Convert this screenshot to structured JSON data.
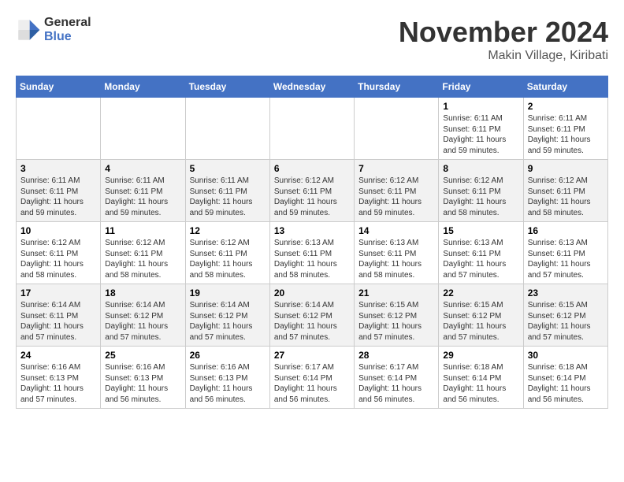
{
  "header": {
    "logo_general": "General",
    "logo_blue": "Blue",
    "month_title": "November 2024",
    "location": "Makin Village, Kiribati"
  },
  "days_of_week": [
    "Sunday",
    "Monday",
    "Tuesday",
    "Wednesday",
    "Thursday",
    "Friday",
    "Saturday"
  ],
  "weeks": [
    [
      {
        "day": "",
        "info": ""
      },
      {
        "day": "",
        "info": ""
      },
      {
        "day": "",
        "info": ""
      },
      {
        "day": "",
        "info": ""
      },
      {
        "day": "",
        "info": ""
      },
      {
        "day": "1",
        "info": "Sunrise: 6:11 AM\nSunset: 6:11 PM\nDaylight: 11 hours\nand 59 minutes."
      },
      {
        "day": "2",
        "info": "Sunrise: 6:11 AM\nSunset: 6:11 PM\nDaylight: 11 hours\nand 59 minutes."
      }
    ],
    [
      {
        "day": "3",
        "info": "Sunrise: 6:11 AM\nSunset: 6:11 PM\nDaylight: 11 hours\nand 59 minutes."
      },
      {
        "day": "4",
        "info": "Sunrise: 6:11 AM\nSunset: 6:11 PM\nDaylight: 11 hours\nand 59 minutes."
      },
      {
        "day": "5",
        "info": "Sunrise: 6:11 AM\nSunset: 6:11 PM\nDaylight: 11 hours\nand 59 minutes."
      },
      {
        "day": "6",
        "info": "Sunrise: 6:12 AM\nSunset: 6:11 PM\nDaylight: 11 hours\nand 59 minutes."
      },
      {
        "day": "7",
        "info": "Sunrise: 6:12 AM\nSunset: 6:11 PM\nDaylight: 11 hours\nand 59 minutes."
      },
      {
        "day": "8",
        "info": "Sunrise: 6:12 AM\nSunset: 6:11 PM\nDaylight: 11 hours\nand 58 minutes."
      },
      {
        "day": "9",
        "info": "Sunrise: 6:12 AM\nSunset: 6:11 PM\nDaylight: 11 hours\nand 58 minutes."
      }
    ],
    [
      {
        "day": "10",
        "info": "Sunrise: 6:12 AM\nSunset: 6:11 PM\nDaylight: 11 hours\nand 58 minutes."
      },
      {
        "day": "11",
        "info": "Sunrise: 6:12 AM\nSunset: 6:11 PM\nDaylight: 11 hours\nand 58 minutes."
      },
      {
        "day": "12",
        "info": "Sunrise: 6:12 AM\nSunset: 6:11 PM\nDaylight: 11 hours\nand 58 minutes."
      },
      {
        "day": "13",
        "info": "Sunrise: 6:13 AM\nSunset: 6:11 PM\nDaylight: 11 hours\nand 58 minutes."
      },
      {
        "day": "14",
        "info": "Sunrise: 6:13 AM\nSunset: 6:11 PM\nDaylight: 11 hours\nand 58 minutes."
      },
      {
        "day": "15",
        "info": "Sunrise: 6:13 AM\nSunset: 6:11 PM\nDaylight: 11 hours\nand 57 minutes."
      },
      {
        "day": "16",
        "info": "Sunrise: 6:13 AM\nSunset: 6:11 PM\nDaylight: 11 hours\nand 57 minutes."
      }
    ],
    [
      {
        "day": "17",
        "info": "Sunrise: 6:14 AM\nSunset: 6:11 PM\nDaylight: 11 hours\nand 57 minutes."
      },
      {
        "day": "18",
        "info": "Sunrise: 6:14 AM\nSunset: 6:12 PM\nDaylight: 11 hours\nand 57 minutes."
      },
      {
        "day": "19",
        "info": "Sunrise: 6:14 AM\nSunset: 6:12 PM\nDaylight: 11 hours\nand 57 minutes."
      },
      {
        "day": "20",
        "info": "Sunrise: 6:14 AM\nSunset: 6:12 PM\nDaylight: 11 hours\nand 57 minutes."
      },
      {
        "day": "21",
        "info": "Sunrise: 6:15 AM\nSunset: 6:12 PM\nDaylight: 11 hours\nand 57 minutes."
      },
      {
        "day": "22",
        "info": "Sunrise: 6:15 AM\nSunset: 6:12 PM\nDaylight: 11 hours\nand 57 minutes."
      },
      {
        "day": "23",
        "info": "Sunrise: 6:15 AM\nSunset: 6:12 PM\nDaylight: 11 hours\nand 57 minutes."
      }
    ],
    [
      {
        "day": "24",
        "info": "Sunrise: 6:16 AM\nSunset: 6:13 PM\nDaylight: 11 hours\nand 57 minutes."
      },
      {
        "day": "25",
        "info": "Sunrise: 6:16 AM\nSunset: 6:13 PM\nDaylight: 11 hours\nand 56 minutes."
      },
      {
        "day": "26",
        "info": "Sunrise: 6:16 AM\nSunset: 6:13 PM\nDaylight: 11 hours\nand 56 minutes."
      },
      {
        "day": "27",
        "info": "Sunrise: 6:17 AM\nSunset: 6:14 PM\nDaylight: 11 hours\nand 56 minutes."
      },
      {
        "day": "28",
        "info": "Sunrise: 6:17 AM\nSunset: 6:14 PM\nDaylight: 11 hours\nand 56 minutes."
      },
      {
        "day": "29",
        "info": "Sunrise: 6:18 AM\nSunset: 6:14 PM\nDaylight: 11 hours\nand 56 minutes."
      },
      {
        "day": "30",
        "info": "Sunrise: 6:18 AM\nSunset: 6:14 PM\nDaylight: 11 hours\nand 56 minutes."
      }
    ]
  ]
}
